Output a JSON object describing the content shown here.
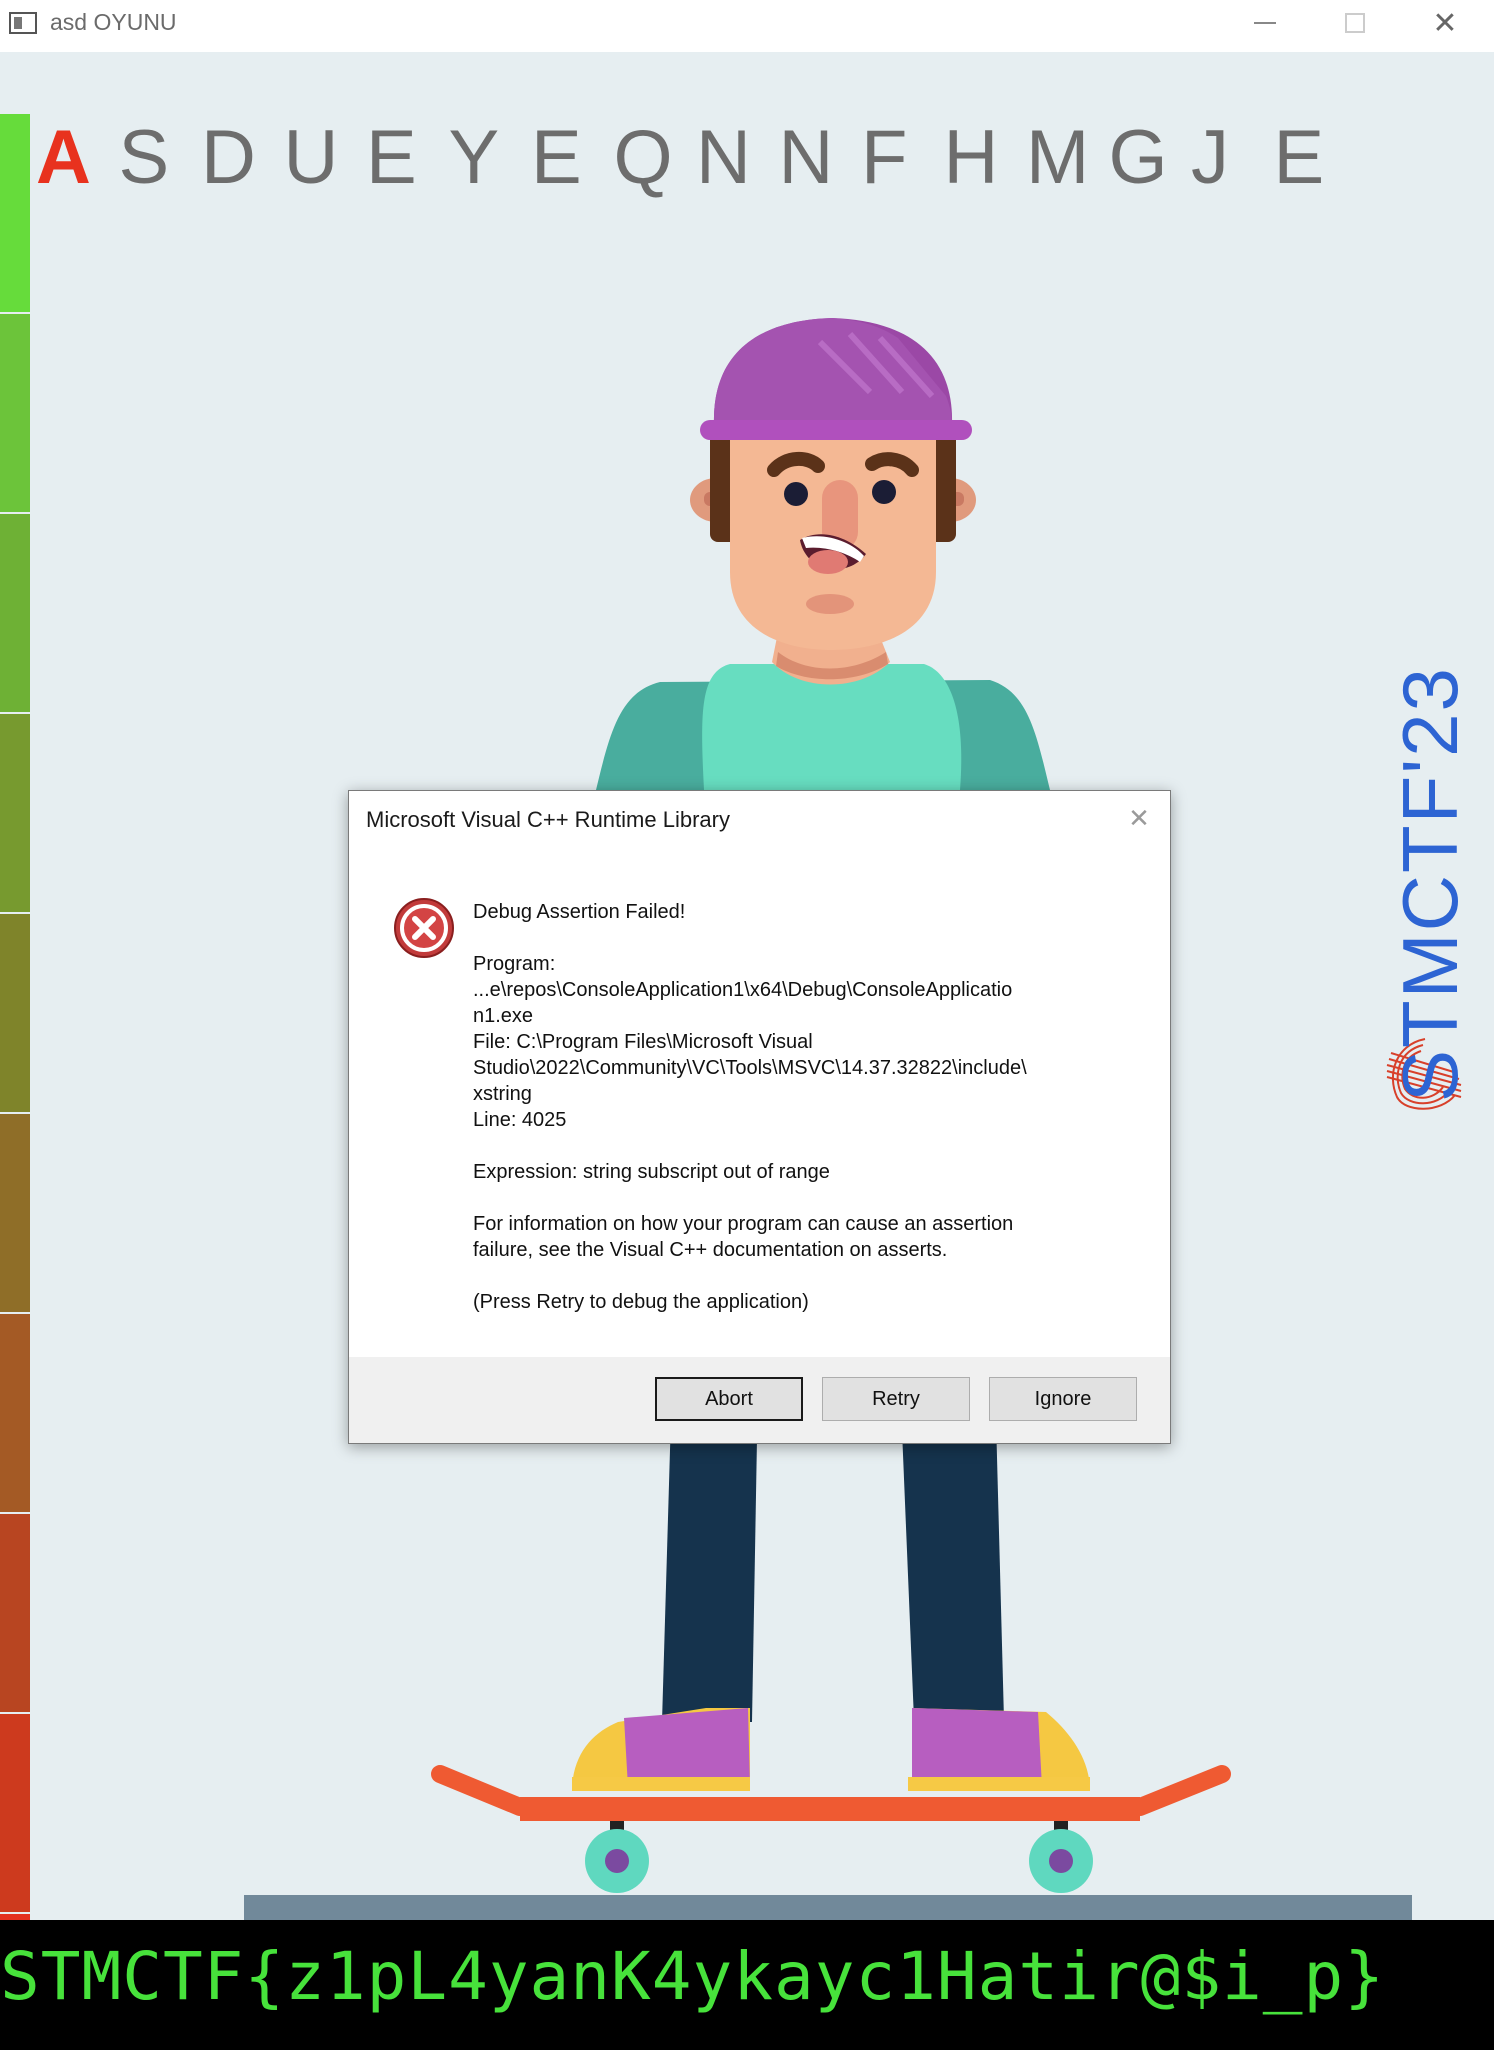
{
  "window": {
    "title": "asd OYUNU",
    "minimize_symbol": "",
    "close_symbol": "✕"
  },
  "game": {
    "letters": [
      "A",
      "S",
      "D",
      "U",
      "E",
      "Y",
      "E",
      "Q",
      "N",
      "N",
      "F",
      "H",
      "M",
      "G",
      "J",
      "E"
    ],
    "active_letter_index": 0,
    "side_banner": "STMCTF'23",
    "meter_colors": [
      "#66dc3b",
      "#6cc43a",
      "#6eb135",
      "#779a2f",
      "#7f842a",
      "#8f6e28",
      "#a45a25",
      "#b84521",
      "#cd3a1e",
      "#e43120"
    ]
  },
  "dialog": {
    "title": "Microsoft Visual C++ Runtime Library",
    "close_symbol": "✕",
    "icon": "error-icon",
    "heading": "Debug Assertion Failed!",
    "program_label": "Program:",
    "program_line1": "...e\\repos\\ConsoleApplication1\\x64\\Debug\\ConsoleApplicatio",
    "program_line2": "n1.exe",
    "file_line1": "File: C:\\Program Files\\Microsoft Visual",
    "file_line2": "Studio\\2022\\Community\\VC\\Tools\\MSVC\\14.37.32822\\include\\",
    "file_line3": "xstring",
    "line": "Line: 4025",
    "expression": "Expression: string subscript out of range",
    "info_line1": "For information on how your program can cause an assertion",
    "info_line2": "failure, see the Visual C++ documentation on asserts.",
    "hint": "(Press Retry to debug the application)",
    "buttons": {
      "abort": "Abort",
      "retry": "Retry",
      "ignore": "Ignore"
    }
  },
  "console": {
    "flag": "STMCTF{z1pL4yanK4ykayc1Hatir@$i_p}"
  }
}
